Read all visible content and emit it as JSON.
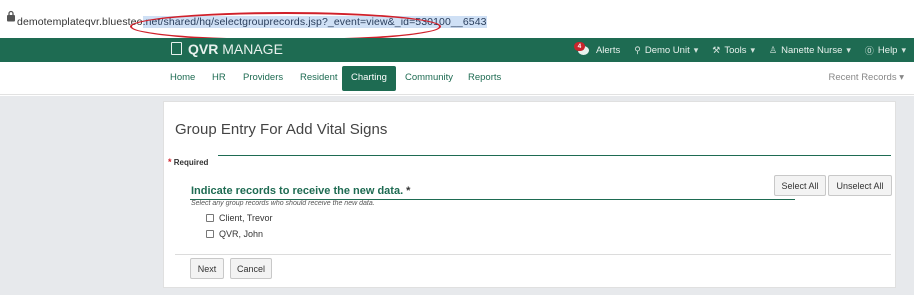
{
  "browser": {
    "url_prefix": "demotemplateqvr.bluesteo",
    "url_selected": ".net/shared/hq/selectgrouprecords.jsp?_event=view&_id=530100__6543"
  },
  "app": {
    "brand_bold": "QVR",
    "brand_rest": " MANAGE"
  },
  "topnav": {
    "alerts_count": "4",
    "alerts": "Alerts",
    "unit": "Demo Unit",
    "tools": "Tools",
    "user": "Nanette Nurse",
    "help": "Help"
  },
  "tabs": [
    "Home",
    "HR",
    "Providers",
    "Resident",
    "Charting",
    "Community",
    "Reports"
  ],
  "active_tab": "Charting",
  "recent_records": "Recent Records",
  "form": {
    "title": "Group Entry For Add Vital Signs",
    "required_label": "Required",
    "section_title": "Indicate records to receive the new data.",
    "hint": "Select any group records who should receive the new data.",
    "select_all": "Select All",
    "unselect_all": "Unselect All",
    "records": [
      "Client, Trevor",
      "QVR, John"
    ],
    "next": "Next",
    "cancel": "Cancel"
  },
  "colors": {
    "brand_green": "#1e6b52",
    "annotation_red": "#d0202a"
  }
}
